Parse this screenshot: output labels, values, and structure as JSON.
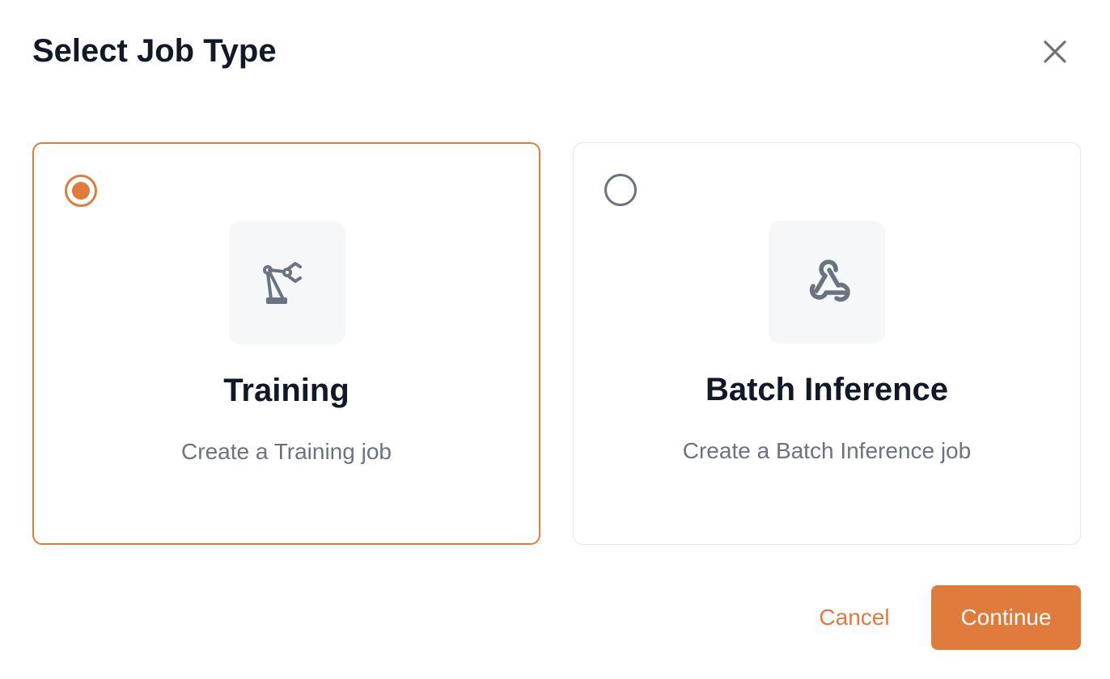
{
  "dialog": {
    "title": "Select Job Type",
    "close_icon": "close-icon"
  },
  "options": [
    {
      "title": "Training",
      "description": "Create a Training job",
      "icon": "robotic-arm-icon",
      "selected": true
    },
    {
      "title": "Batch Inference",
      "description": "Create a Batch Inference job",
      "icon": "webhook-icon",
      "selected": false
    }
  ],
  "footer": {
    "cancel_label": "Cancel",
    "continue_label": "Continue"
  },
  "colors": {
    "accent": "#e07b3c",
    "title_text": "#111827",
    "muted_text": "#6b7280",
    "icon_gray": "#6b7280",
    "icon_bg": "#f6f7f9",
    "card_border": "#e5e7eb"
  }
}
